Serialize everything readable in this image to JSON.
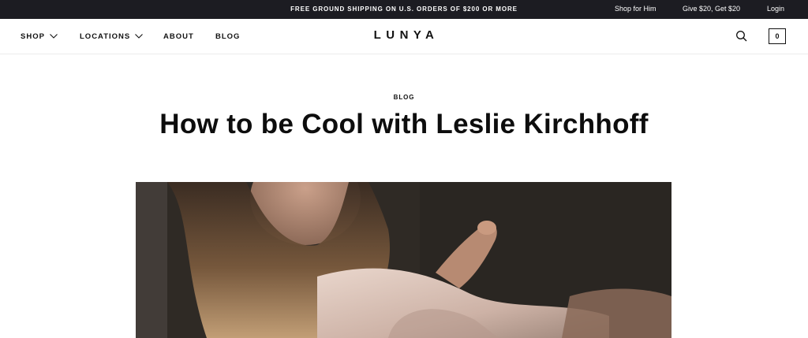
{
  "announcement": "FREE GROUND SHIPPING ON U.S. ORDERS OF $200 OR MORE",
  "utility_links": {
    "shop_for_him": "Shop for Him",
    "give_get": "Give $20, Get $20",
    "login": "Login"
  },
  "nav": {
    "shop": "SHOP",
    "locations": "LOCATIONS",
    "about": "ABOUT",
    "blog": "BLOG"
  },
  "logo": "LUNYA",
  "cart_count": "0",
  "article": {
    "category": "BLOG",
    "title": "How to be Cool with Leslie Kirchhoff"
  },
  "icons": {
    "search": "search-icon",
    "cart": "cart-icon",
    "chevron": "chevron-down-icon"
  },
  "colors": {
    "topbar_bg": "#1c1c22",
    "text": "#111111",
    "page_bg": "#ffffff"
  }
}
